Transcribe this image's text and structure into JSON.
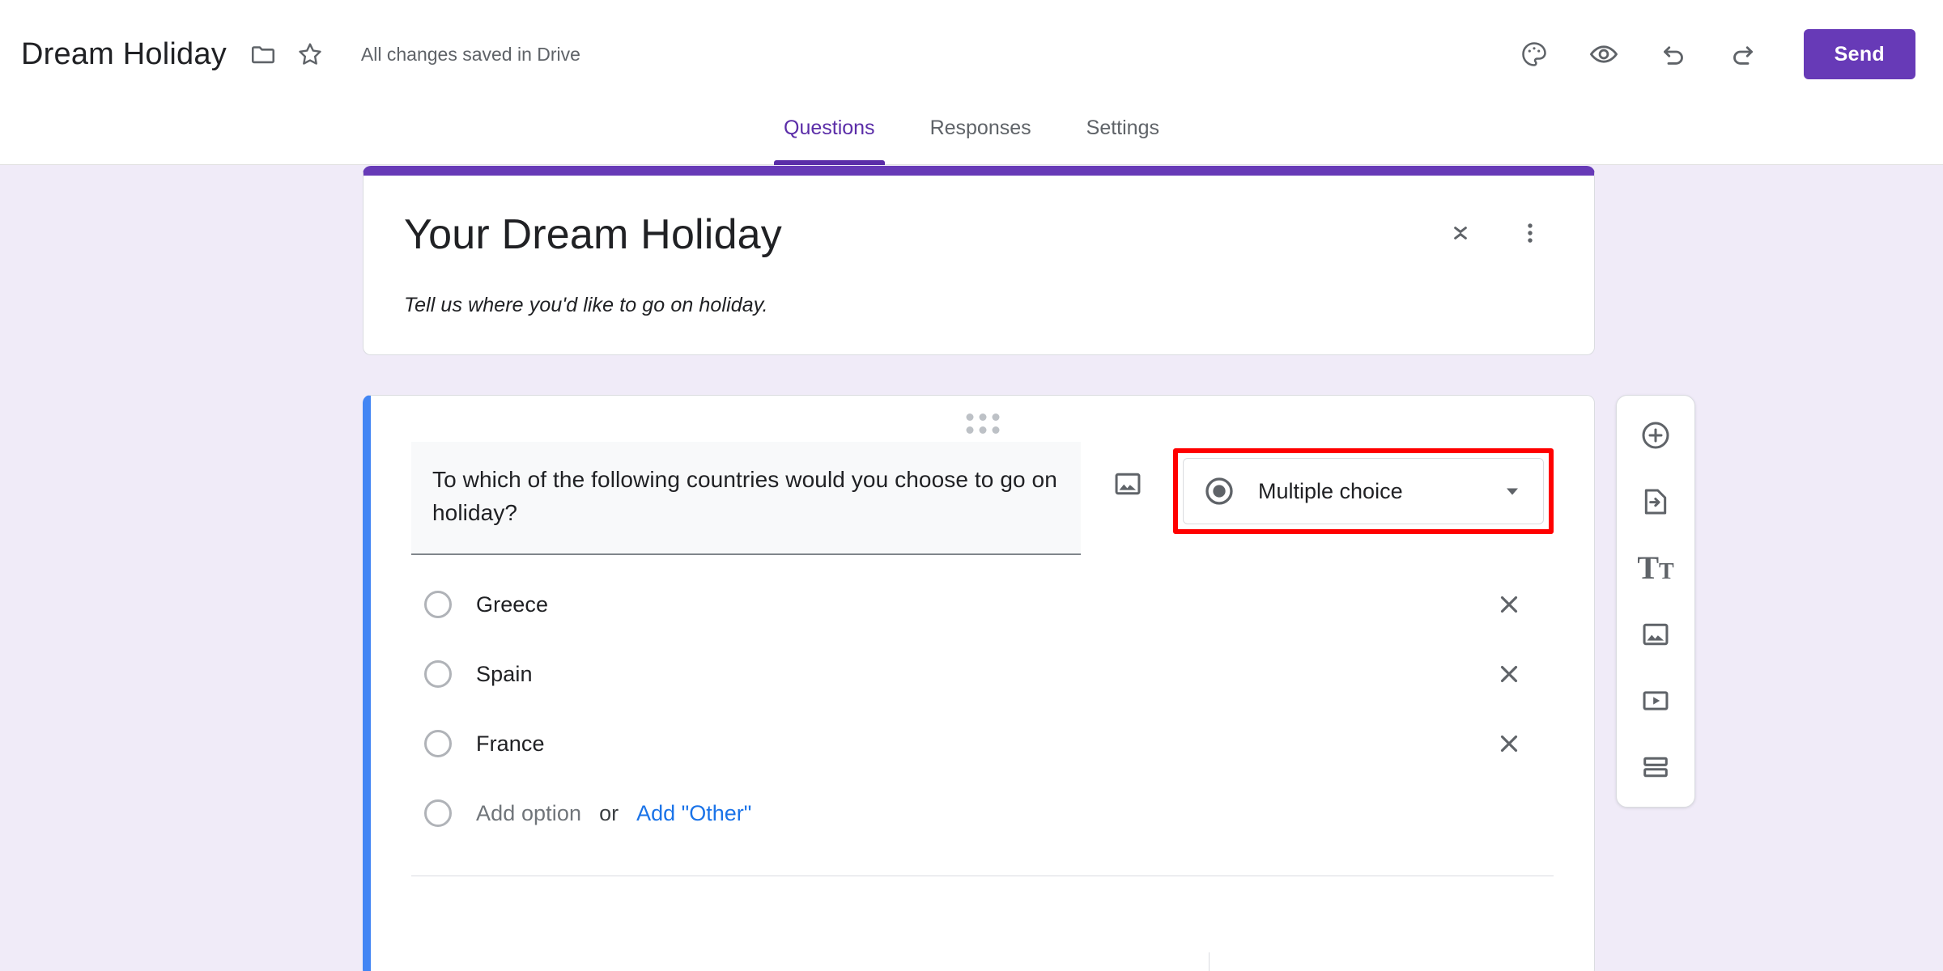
{
  "topbar": {
    "doc_title": "Dream Holiday",
    "move_folder_icon": "folder-icon",
    "star_icon": "star-icon",
    "save_status": "All changes saved in Drive",
    "theme_icon": "palette-icon",
    "preview_icon": "eye-icon",
    "undo_icon": "undo-icon",
    "redo_icon": "redo-icon",
    "send_label": "Send",
    "send_color": "#673ab7"
  },
  "tabs": [
    {
      "label": "Questions",
      "active": true
    },
    {
      "label": "Responses",
      "active": false
    },
    {
      "label": "Settings",
      "active": false
    }
  ],
  "form_header": {
    "title": "Your Dream Holiday",
    "description": "Tell us where you'd like to go on holiday.",
    "collapse_icon": "collapse-icon",
    "more_icon": "more-vertical-icon",
    "accent_color": "#673ab7"
  },
  "question": {
    "drag_handle_icon": "drag-handle-icon",
    "text": "To which of the following countries would you choose to go on holiday?",
    "image_icon": "add-image-icon",
    "type": {
      "label": "Multiple choice",
      "icon": "radio-button-icon",
      "caret_icon": "chevron-down-icon",
      "highlight_color": "#ff0000"
    },
    "selected_accent_color": "#4285f4",
    "options": [
      {
        "label": "Greece",
        "remove_icon": "close-icon"
      },
      {
        "label": "Spain",
        "remove_icon": "close-icon"
      },
      {
        "label": "France",
        "remove_icon": "close-icon"
      }
    ],
    "add_option": {
      "label": "Add option",
      "or": "or",
      "other_label": "Add \"Other\""
    }
  },
  "side_toolbar": [
    {
      "icon": "add-question-icon"
    },
    {
      "icon": "import-questions-icon"
    },
    {
      "icon": "add-title-description-icon"
    },
    {
      "icon": "add-image-icon"
    },
    {
      "icon": "add-video-icon"
    },
    {
      "icon": "add-section-icon"
    }
  ]
}
